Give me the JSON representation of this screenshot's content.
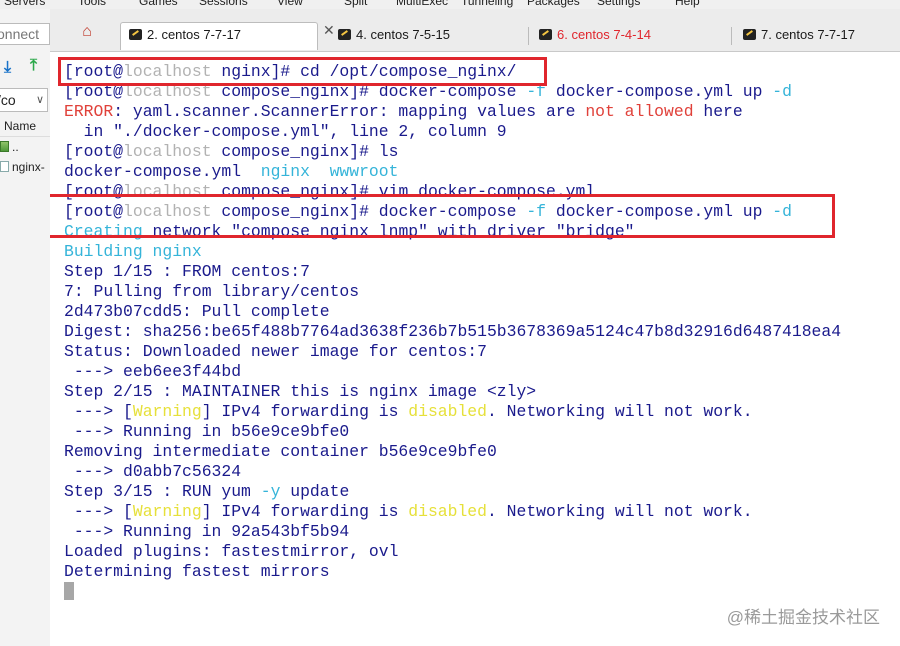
{
  "menu": [
    "Servers",
    "Tools",
    "Games",
    "Sessions",
    "View",
    "Split",
    "MultiExec",
    "Tunneling",
    "Packages",
    "Settings",
    "Help"
  ],
  "sidebar": {
    "connect_text": "onnect",
    "path_value": "/co",
    "name_header": "Name",
    "files": [
      {
        "name": "..",
        "icon": "folder-up-icon"
      },
      {
        "name": "nginx-",
        "icon": "file-icon"
      }
    ]
  },
  "tabs": [
    {
      "label": "2. centos 7-7-17",
      "active": true,
      "color": "#1a1a1a"
    },
    {
      "label": "4. centos 7-5-15",
      "active": false,
      "color": "#1a1a1a"
    },
    {
      "label": "6. centos 7-4-14",
      "active": false,
      "color": "#e0262d"
    },
    {
      "label": "7. centos 7-7-17",
      "active": false,
      "color": "#1a1a1a"
    }
  ],
  "terminal": {
    "lines": [
      [
        {
          "t": "[root@",
          "c": "d"
        },
        {
          "t": "localhost",
          "c": "g"
        },
        {
          "t": " nginx]# cd /opt/compose_nginx/",
          "c": "d"
        }
      ],
      [
        {
          "t": "[root@",
          "c": "d"
        },
        {
          "t": "localhost",
          "c": "g"
        },
        {
          "t": " compose_nginx]# docker-compose ",
          "c": "d"
        },
        {
          "t": "-f",
          "c": "c"
        },
        {
          "t": " docker-compose.yml up ",
          "c": "d"
        },
        {
          "t": "-d",
          "c": "c"
        }
      ],
      [
        {
          "t": "ERROR",
          "c": "r"
        },
        {
          "t": ": yaml.scanner.ScannerError: mapping values are ",
          "c": "d"
        },
        {
          "t": "not allowed",
          "c": "r"
        },
        {
          "t": " here",
          "c": "d"
        }
      ],
      [
        {
          "t": "  in \"./docker-compose.yml\", line 2, column 9",
          "c": "d"
        }
      ],
      [
        {
          "t": "[root@",
          "c": "d"
        },
        {
          "t": "localhost",
          "c": "g"
        },
        {
          "t": " compose_nginx]# ls",
          "c": "d"
        }
      ],
      [
        {
          "t": "docker-compose.yml  ",
          "c": "d"
        },
        {
          "t": "nginx  wwwroot",
          "c": "c"
        }
      ],
      [
        {
          "t": "[root@",
          "c": "d"
        },
        {
          "t": "localhost",
          "c": "g"
        },
        {
          "t": " compose_nginx]# vim docker-compose.yml",
          "c": "d"
        }
      ],
      [
        {
          "t": "[root@",
          "c": "d"
        },
        {
          "t": "localhost",
          "c": "g"
        },
        {
          "t": " compose_nginx]# docker-compose ",
          "c": "d"
        },
        {
          "t": "-f",
          "c": "c"
        },
        {
          "t": " docker-compose.yml up ",
          "c": "d"
        },
        {
          "t": "-d",
          "c": "c"
        }
      ],
      [
        {
          "t": "Creating",
          "c": "c"
        },
        {
          "t": " network \"compose_nginx_lnmp\" with driver \"bridge\"",
          "c": "d"
        }
      ],
      [
        {
          "t": "Building nginx",
          "c": "c"
        }
      ],
      [
        {
          "t": "Step 1/15 : FROM centos:7",
          "c": "d"
        }
      ],
      [
        {
          "t": "7: Pulling from library/centos",
          "c": "d"
        }
      ],
      [
        {
          "t": "2d473b07cdd5: Pull complete",
          "c": "d"
        }
      ],
      [
        {
          "t": "Digest: sha256:be65f488b7764ad3638f236b7b515b3678369a5124c47b8d32916d6487418ea4",
          "c": "d"
        }
      ],
      [
        {
          "t": "Status: Downloaded newer image for centos:7",
          "c": "d"
        }
      ],
      [
        {
          "t": " ---> eeb6ee3f44bd",
          "c": "d"
        }
      ],
      [
        {
          "t": "Step 2/15 : MAINTAINER this is nginx image <zly>",
          "c": "d"
        }
      ],
      [
        {
          "t": " ---> [",
          "c": "d"
        },
        {
          "t": "Warning",
          "c": "y"
        },
        {
          "t": "] IPv4 forwarding is ",
          "c": "d"
        },
        {
          "t": "disabled",
          "c": "y"
        },
        {
          "t": ". Networking will not work.",
          "c": "d"
        }
      ],
      [
        {
          "t": " ---> Running in b56e9ce9bfe0",
          "c": "d"
        }
      ],
      [
        {
          "t": "Removing intermediate container b56e9ce9bfe0",
          "c": "d"
        }
      ],
      [
        {
          "t": " ---> d0abb7c56324",
          "c": "d"
        }
      ],
      [
        {
          "t": "Step 3/15 : RUN yum ",
          "c": "d"
        },
        {
          "t": "-y",
          "c": "c"
        },
        {
          "t": " update",
          "c": "d"
        }
      ],
      [
        {
          "t": " ---> [",
          "c": "d"
        },
        {
          "t": "Warning",
          "c": "y"
        },
        {
          "t": "] IPv4 forwarding is ",
          "c": "d"
        },
        {
          "t": "disabled",
          "c": "y"
        },
        {
          "t": ". Networking will not work.",
          "c": "d"
        }
      ],
      [
        {
          "t": " ---> Running in 92a543bf5b94",
          "c": "d"
        }
      ],
      [
        {
          "t": "Loaded plugins: fastestmirror, ovl",
          "c": "d"
        }
      ],
      [
        {
          "t": "Determining fastest mirrors",
          "c": "d"
        }
      ]
    ]
  },
  "watermark": "@稀土掘金技术社区",
  "colors": {
    "prompt": "#1a1a8c",
    "highlight_box": "#e0262d",
    "hostname": "#b2b2b2",
    "error": "#e0413a",
    "option": "#35b4d9",
    "warning": "#e6e03a"
  }
}
